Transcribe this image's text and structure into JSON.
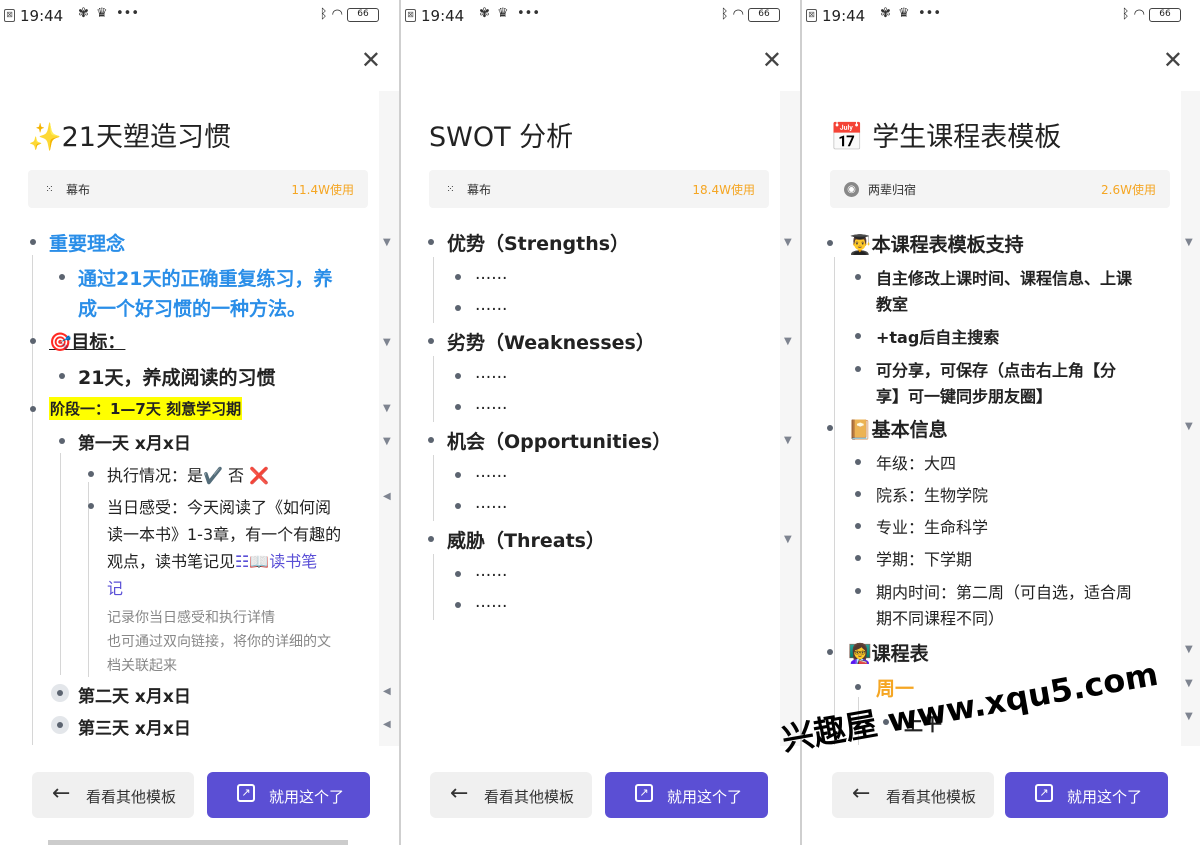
{
  "status_bar": {
    "time": "19:44",
    "battery": "66"
  },
  "buttons": {
    "other_templates": "看看其他模板",
    "use_this": "就用这个了"
  },
  "watermark": "兴趣屋 www.xqu5.com",
  "panel1": {
    "title": "✨21天塑造习惯",
    "author": "幕布",
    "usage": "11.4W使用",
    "items": {
      "idea": "重要理念",
      "idea_text_l1": "通过21天的正确重复练习，养",
      "idea_text_l2": "成一个好习惯的一种方法。",
      "goal": "🎯目标：",
      "goal_text": "21天，养成阅读的习惯",
      "stage1": "阶段一：1—7天 刻意学习期",
      "day1": "第一天 x月x日",
      "exec": "执行情况：是✔️ 否 ❌",
      "feel_l1": "当日感受：今天阅读了《如何阅",
      "feel_l2": "读一本书》1-3章，有一个有趣的",
      "feel_l3_a": "观点，读书笔记见",
      "feel_link_a": "📖读书笔",
      "feel_link_b": "记",
      "note_l1": "记录你当日感受和执行详情",
      "note_l2": "也可通过双向链接，将你的详细的文",
      "note_l3": "档关联起来",
      "day2": "第二天 x月x日",
      "day3": "第三天 x月x日"
    }
  },
  "panel2": {
    "title": "SWOT 分析",
    "author": "幕布",
    "usage": "18.4W使用",
    "items": {
      "s": "优势（Strengths）",
      "w": "劣势（Weaknesses）",
      "o": "机会（Opportunities）",
      "t": "威胁（Threats）",
      "placeholder": "......"
    }
  },
  "panel3": {
    "title": "📅 学生课程表模板",
    "author": "两辈归宿",
    "usage": "2.6W使用",
    "items": {
      "support": "👨‍🎓本课程表模板支持",
      "sup1_l1": "自主修改上课时间、课程信息、上课",
      "sup1_l2": "教室",
      "sup2": "+tag后自主搜索",
      "sup3_l1": "可分享，可保存（点击右上角【分",
      "sup3_l2": "享】可一键同步朋友圈】",
      "basic": "📔基本信息",
      "grade": "年级：大四",
      "dept": "院系：生物学院",
      "major": "专业：生命科学",
      "term": "学期：下学期",
      "period_l1": "期内时间：第二周（可自选，适合周",
      "period_l2": "期不同课程不同）",
      "schedule": "👩‍🏫课程表",
      "monday": "周一",
      "morning": "上午"
    }
  }
}
